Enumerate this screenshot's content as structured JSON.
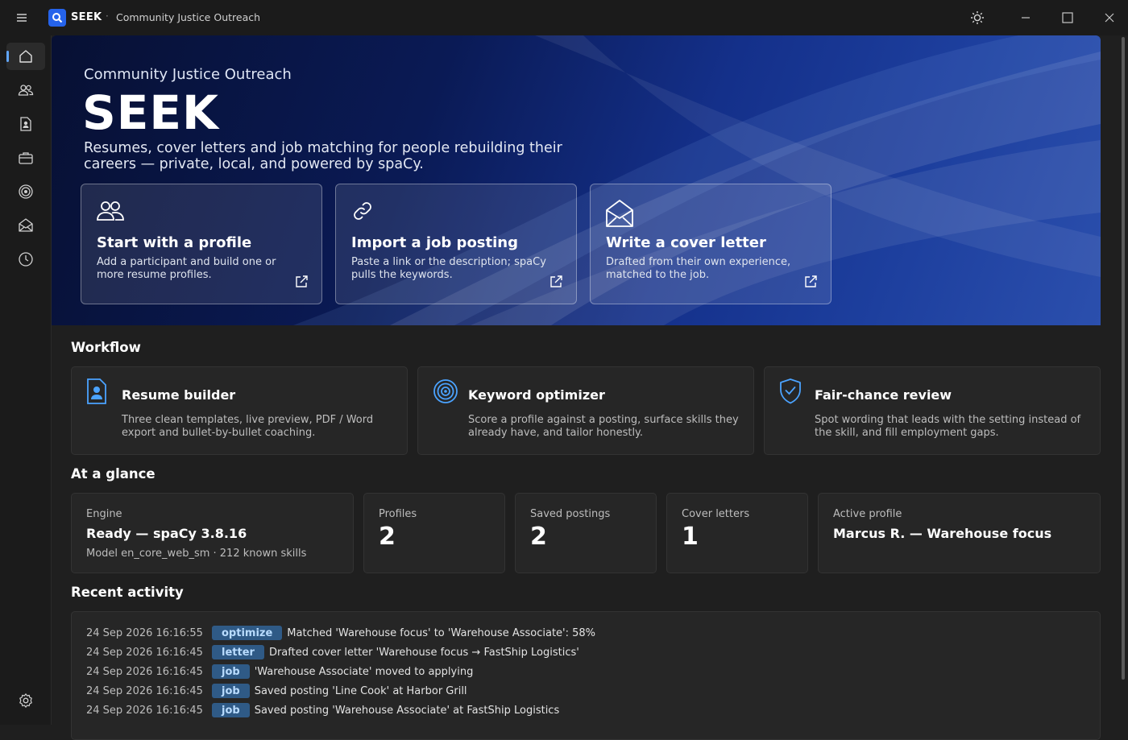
{
  "titlebar": {
    "app_name": "SEEK",
    "separator": "·",
    "org": "Community Justice Outreach"
  },
  "sidebar": {
    "items": [
      {
        "name": "home",
        "icon": "home-icon",
        "active": true
      },
      {
        "name": "participants",
        "icon": "people-icon",
        "active": false
      },
      {
        "name": "resumes",
        "icon": "profile-document-icon",
        "active": false
      },
      {
        "name": "jobs",
        "icon": "briefcase-icon",
        "active": false
      },
      {
        "name": "optimizer",
        "icon": "target-icon",
        "active": false
      },
      {
        "name": "letters",
        "icon": "envelope-icon",
        "active": false
      },
      {
        "name": "history",
        "icon": "clock-icon",
        "active": false
      }
    ],
    "settings_icon": "gear-icon"
  },
  "hero": {
    "org": "Community Justice Outreach",
    "title": "SEEK",
    "subtitle": "Resumes, cover letters and job matching for people rebuilding their careers — private, local, and powered by spaCy.",
    "cards": [
      {
        "title": "Start with a profile",
        "desc": "Add a participant and build one or more resume profiles.",
        "icon": "people-icon"
      },
      {
        "title": "Import a job posting",
        "desc": "Paste a link or the description; spaCy pulls the keywords.",
        "icon": "link-icon"
      },
      {
        "title": "Write a cover letter",
        "desc": "Drafted from their own experience, matched to the job.",
        "icon": "envelope-open-icon"
      }
    ]
  },
  "workflow": {
    "heading": "Workflow",
    "cards": [
      {
        "title": "Resume builder",
        "desc": "Three clean templates, live preview, PDF / Word export and bullet-by-bullet coaching.",
        "icon": "profile-document-icon"
      },
      {
        "title": "Keyword optimizer",
        "desc": "Score a profile against a posting, surface skills they already have, and tailor honestly.",
        "icon": "target-icon"
      },
      {
        "title": "Fair-chance review",
        "desc": "Spot wording that leads with the setting instead of the skill, and fill employment gaps.",
        "icon": "shield-check-icon"
      }
    ]
  },
  "glance": {
    "heading": "At a glance",
    "engine": {
      "label": "Engine",
      "value": "Ready — spaCy 3.8.16",
      "sub": "Model en_core_web_sm · 212 known skills"
    },
    "profiles": {
      "label": "Profiles",
      "value": "2"
    },
    "postings": {
      "label": "Saved postings",
      "value": "2"
    },
    "letters": {
      "label": "Cover letters",
      "value": "1"
    },
    "active": {
      "label": "Active profile",
      "value": "Marcus R. — Warehouse focus"
    }
  },
  "activity": {
    "heading": "Recent activity",
    "rows": [
      {
        "time": "24 Sep 2026 16:16:55",
        "tag": "optimize",
        "msg": "Matched 'Warehouse focus' to 'Warehouse Associate': 58%"
      },
      {
        "time": "24 Sep 2026 16:16:45",
        "tag": "letter",
        "msg": "Drafted cover letter 'Warehouse focus → FastShip Logistics'"
      },
      {
        "time": "24 Sep 2026 16:16:45",
        "tag": "job",
        "msg": "'Warehouse Associate' moved to applying"
      },
      {
        "time": "24 Sep 2026 16:16:45",
        "tag": "job",
        "msg": "Saved posting 'Line Cook' at Harbor Grill"
      },
      {
        "time": "24 Sep 2026 16:16:45",
        "tag": "job",
        "msg": "Saved posting 'Warehouse Associate' at FastShip Logistics"
      }
    ]
  },
  "colors": {
    "accent": "#60a5fa",
    "badge_bg": "#2f5a86",
    "logo": "#2563eb"
  }
}
